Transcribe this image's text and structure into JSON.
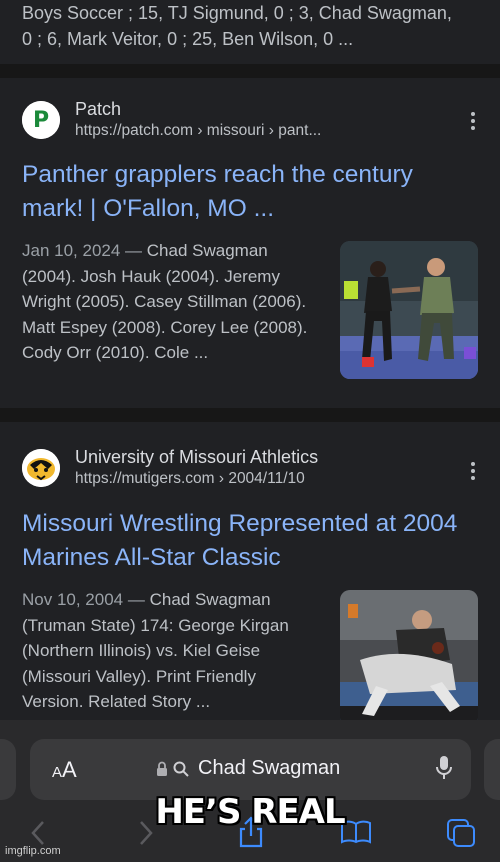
{
  "prev_snippet": {
    "line1": "Boys Soccer ; 15, TJ Sigmund, 0 ; 3, Chad Swagman,",
    "line2": "0 ; 6, Mark Veitor, 0 ; 25, Ben Wilson, 0 ..."
  },
  "results": [
    {
      "favicon_letter": "P",
      "source": "Patch",
      "url": "https://patch.com › missouri › pant...",
      "title": "Panther grapplers reach the century mark! | O'Fallon, MO ...",
      "date": "Jan 10, 2024",
      "snippet": "Chad Swagman (2004). Josh Hauk (2004). Jeremy Wright (2005). Casey Stillman (2006). Matt Espey (2008). Corey Lee (2008). Cody Orr (2010). Cole ...",
      "thumb_icon": "wrestling-photo-icon"
    },
    {
      "favicon_icon": "tiger-logo-icon",
      "source": "University of Missouri Athletics",
      "url": "https://mutigers.com › 2004/11/10",
      "title": "Missouri Wrestling Represented at 2004 Marines All-Star Classic",
      "date": "Nov 10, 2004",
      "snippet": "Chad Swagman (Truman State) 174: George Kirgan (Northern Illinois) vs. Kiel Geise (Missouri Valley). Print Friendly Version. Related Story ...",
      "thumb_icon": "wrestling-photo-icon"
    }
  ],
  "date_separator": "—",
  "toolbar": {
    "aa_small": "A",
    "aa_large": "A",
    "query": "Chad Swagman",
    "lock_icon": "lock-icon",
    "search_icon": "search-icon",
    "mic_icon": "mic-icon"
  },
  "caption": "HE’S REAL",
  "watermark": "imgflip.com",
  "colors": {
    "background": "#202124",
    "link": "#8ab4f8",
    "text": "#bdc1c6",
    "toolbar": "#2a2a2c"
  }
}
